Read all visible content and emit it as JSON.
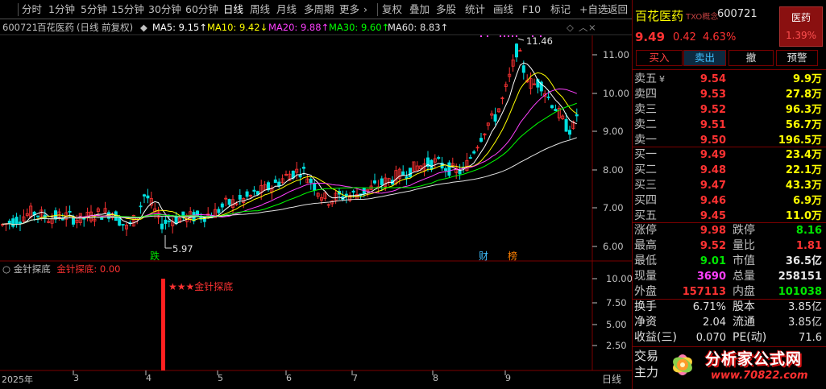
{
  "toolbar": {
    "items": [
      "分时",
      "1分钟",
      "5分钟",
      "15分钟",
      "30分钟",
      "60分钟",
      "日线",
      "周线",
      "月线",
      "多周期",
      "更多",
      "复权",
      "叠加",
      "多股",
      "统计",
      "画线",
      "F10",
      "标记",
      "+自选",
      "返回"
    ],
    "more_arrow": "›"
  },
  "chart_info": {
    "code": "600721",
    "name": "百花医药",
    "mode": "(日线 前复权)",
    "ma": [
      {
        "label": "MA5:",
        "value": "9.15",
        "arrow": "↑",
        "color": "#ffffff"
      },
      {
        "label": "MA10:",
        "value": "9.42",
        "arrow": "↓",
        "color": "#ffff00"
      },
      {
        "label": "MA20:",
        "value": "9.88",
        "arrow": "↑",
        "color": "#ff40ff"
      },
      {
        "label": "MA30:",
        "value": "9.60",
        "arrow": "↑",
        "color": "#00ff00"
      },
      {
        "label": "MA60:",
        "value": "8.83",
        "arrow": "↑",
        "color": "#e0e0e0"
      }
    ]
  },
  "price_axis": [
    "11.00",
    "10.00",
    "9.00",
    "8.00",
    "7.00",
    "6.00"
  ],
  "annotations": {
    "high": "11.46",
    "low": "5.97",
    "marker_fall": "跌",
    "marker_cai": "财",
    "marker_bang": "榜"
  },
  "indicator": {
    "name": "金针探底",
    "label": "金针探底:",
    "value": "0.00",
    "signal_text": "★★★金针探底",
    "axis": [
      "10.00",
      "7.50",
      "5.00",
      "2.50"
    ]
  },
  "dates": [
    "2025年",
    "3",
    "4",
    "5",
    "6",
    "7",
    "8",
    "9"
  ],
  "period_label": "日线",
  "quote": {
    "name": "百花医药",
    "tag": "TXO概念",
    "code": "600721",
    "industry_button": "医药",
    "industry_change": "1.39%",
    "price": "9.49",
    "change": "0.42",
    "change_pct": "4.63%",
    "buttons": [
      "买入",
      "卖出",
      "撤",
      "预警"
    ],
    "asks": [
      {
        "label": "卖五",
        "price": "9.54",
        "vol": "9.9万"
      },
      {
        "label": "卖四",
        "price": "9.53",
        "vol": "27.8万"
      },
      {
        "label": "卖三",
        "price": "9.52",
        "vol": "96.3万"
      },
      {
        "label": "卖二",
        "price": "9.51",
        "vol": "56.7万"
      },
      {
        "label": "卖一",
        "price": "9.50",
        "vol": "196.5万"
      }
    ],
    "bids": [
      {
        "label": "买一",
        "price": "9.49",
        "vol": "23.4万"
      },
      {
        "label": "买二",
        "price": "9.48",
        "vol": "22.1万"
      },
      {
        "label": "买三",
        "price": "9.47",
        "vol": "43.3万"
      },
      {
        "label": "买四",
        "price": "9.46",
        "vol": "6.9万"
      },
      {
        "label": "买五",
        "price": "9.45",
        "vol": "11.0万"
      }
    ],
    "ask_marker": "¥",
    "stats": [
      {
        "l1": "涨停",
        "v1": "9.98",
        "l2": "跌停",
        "v2": "8.16",
        "c1": "red",
        "c2": "green"
      },
      {
        "l1": "最高",
        "v1": "9.52",
        "l2": "量比",
        "v2": "1.81",
        "c1": "red",
        "c2": "red"
      },
      {
        "l1": "最低",
        "v1": "9.01",
        "l2": "市值",
        "v2": "36.5亿",
        "c1": "green",
        "c2": "white"
      },
      {
        "l1": "现量",
        "v1": "3690",
        "l2": "总量",
        "v2": "258151",
        "c1": "magenta",
        "c2": "white"
      },
      {
        "l1": "外盘",
        "v1": "157113",
        "l2": "内盘",
        "v2": "101038",
        "c1": "red",
        "c2": "green"
      }
    ],
    "finance": [
      {
        "l1": "换手",
        "v1": "6.71%",
        "l2": "股本",
        "v2": "3.85亿"
      },
      {
        "l1": "净资",
        "v1": "2.04",
        "l2": "流通",
        "v2": "3.85亿"
      },
      {
        "l1": "收益(三)",
        "v1": "0.070",
        "l2": "PE(动)",
        "v2": "71.6"
      }
    ],
    "bottom": [
      "交易",
      "主力"
    ]
  },
  "watermark": {
    "title": "分析家公式网",
    "url": "www.70822.com"
  },
  "colors": {
    "up": "#ff3232",
    "down": "#00e0e0",
    "border": "#7a0000"
  }
}
